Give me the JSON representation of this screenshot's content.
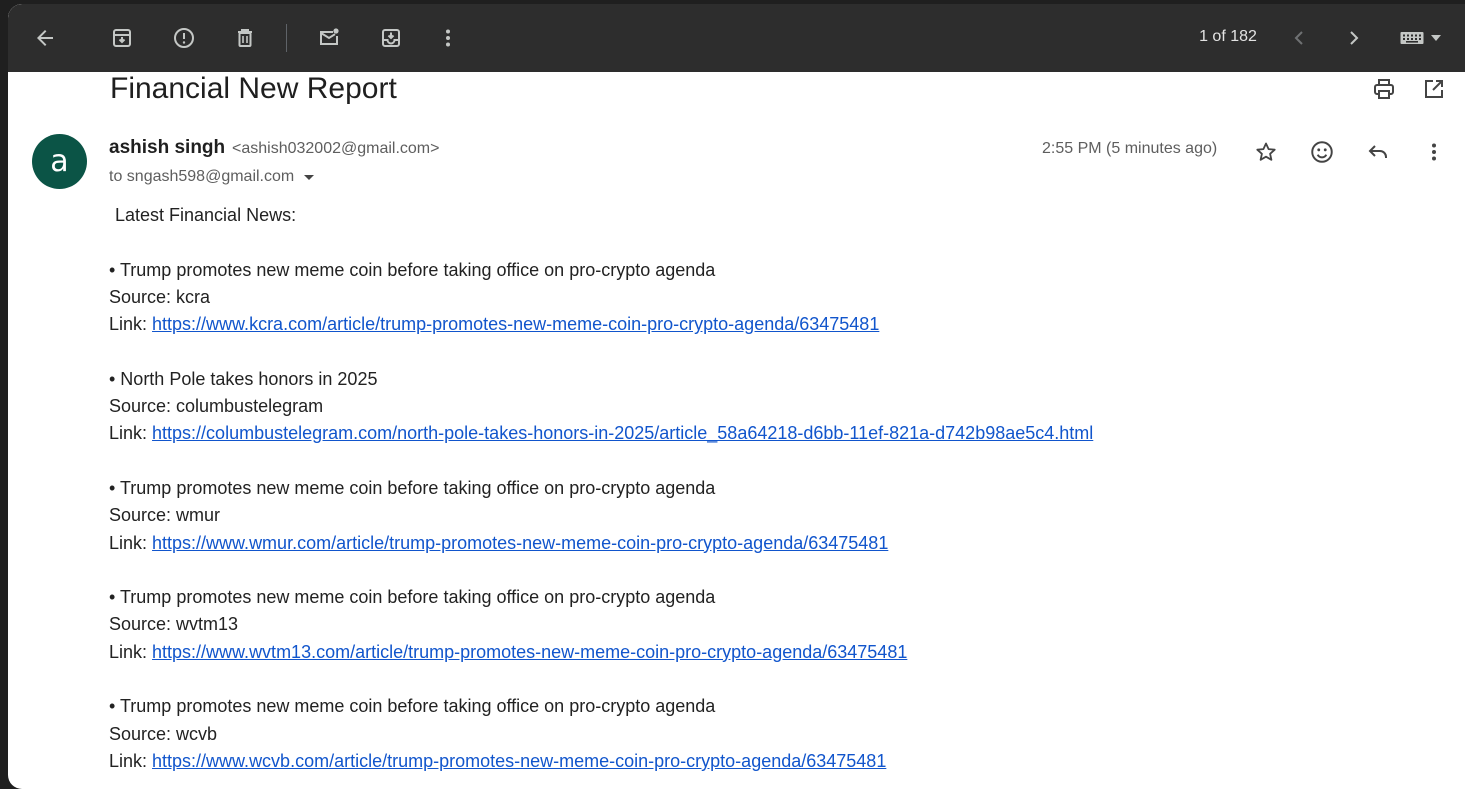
{
  "toolbar": {
    "pager": "1 of 182"
  },
  "email": {
    "subject": "Financial New Report",
    "avatar_letter": "a",
    "sender_name": "ashish singh",
    "sender_email": "<ashish032002@gmail.com>",
    "recipient": "to sngash598@gmail.com",
    "timestamp": "2:55 PM (5 minutes ago)",
    "intro": "Latest Financial News:",
    "items": [
      {
        "headline": "• Trump promotes new meme coin before taking office on pro-crypto agenda",
        "source": "Source: kcra",
        "link_label": "Link: ",
        "url": "https://www.kcra.com/article/trump-promotes-new-meme-coin-pro-crypto-agenda/63475481"
      },
      {
        "headline": "• North Pole takes honors in 2025",
        "source": "Source: columbustelegram",
        "link_label": "Link: ",
        "url": "https://columbustelegram.com/north-pole-takes-honors-in-2025/article_58a64218-d6bb-11ef-821a-d742b98ae5c4.html"
      },
      {
        "headline": "• Trump promotes new meme coin before taking office on pro-crypto agenda",
        "source": "Source: wmur",
        "link_label": "Link: ",
        "url": "https://www.wmur.com/article/trump-promotes-new-meme-coin-pro-crypto-agenda/63475481"
      },
      {
        "headline": "• Trump promotes new meme coin before taking office on pro-crypto agenda",
        "source": "Source: wvtm13",
        "link_label": "Link: ",
        "url": "https://www.wvtm13.com/article/trump-promotes-new-meme-coin-pro-crypto-agenda/63475481"
      },
      {
        "headline": "• Trump promotes new meme coin before taking office on pro-crypto agenda",
        "source": "Source: wcvb",
        "link_label": "Link: ",
        "url": "https://www.wcvb.com/article/trump-promotes-new-meme-coin-pro-crypto-agenda/63475481"
      }
    ]
  },
  "colors": {
    "toolbar_bg": "#2d2d2d",
    "avatar_bg": "#0b5446",
    "link": "#1155cc"
  },
  "icons": [
    "back-arrow-icon",
    "archive-icon",
    "report-spam-icon",
    "delete-icon",
    "mark-unread-icon",
    "move-to-icon",
    "more-vert-icon",
    "chevron-left-icon",
    "chevron-right-icon",
    "keyboard-icon",
    "print-icon",
    "open-in-new-window-icon",
    "star-icon",
    "emoji-icon",
    "reply-icon",
    "more-vert-icon"
  ]
}
